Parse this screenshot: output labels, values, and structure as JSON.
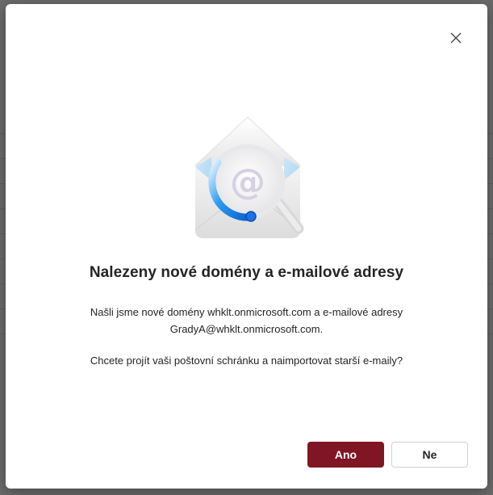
{
  "dialog": {
    "title": "Nalezeny nové domény a e-mailové adresy",
    "message_line1": "Našli jsme nové domény whklt.onmicrosoft.com a e-mailové adresy",
    "message_line2": "GradyA@whklt.onmicrosoft.com.",
    "question": "Chcete projít vaši poštovní schránku a naimportovat starší e-maily?",
    "yes_label": "Ano",
    "no_label": "Ne",
    "close_icon": "close-icon",
    "illustration_icon": "envelope-search-icon"
  },
  "colors": {
    "primary": "#801624",
    "text": "#242424",
    "secondary_border": "#d1d1d1"
  }
}
